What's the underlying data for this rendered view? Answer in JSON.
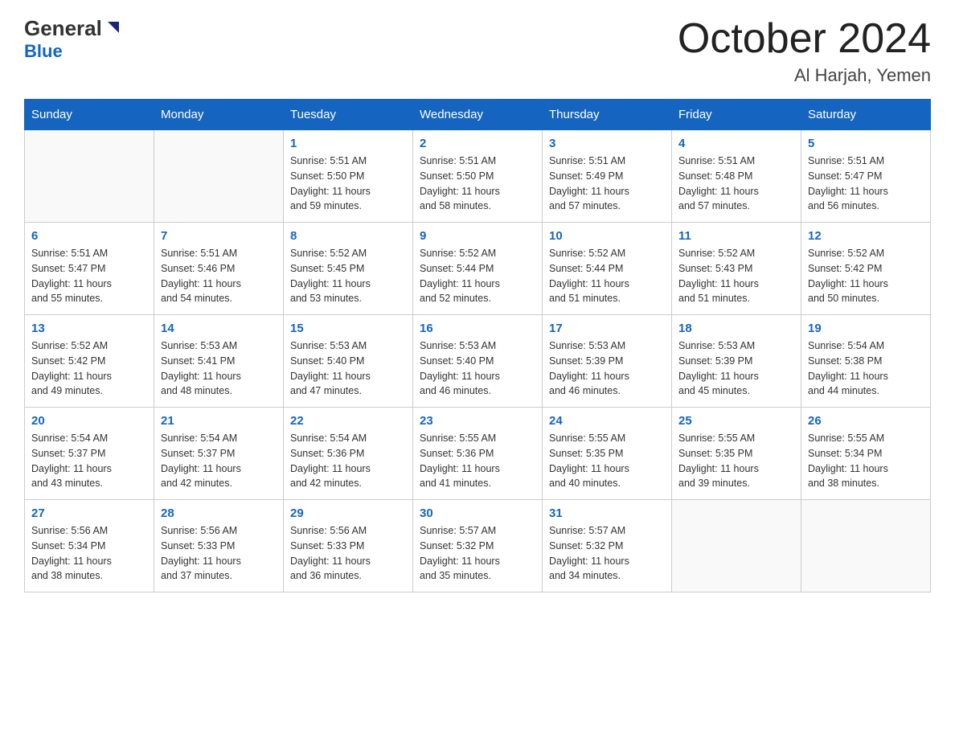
{
  "header": {
    "logo_general": "General",
    "logo_blue": "Blue",
    "title": "October 2024",
    "subtitle": "Al Harjah, Yemen"
  },
  "days_of_week": [
    "Sunday",
    "Monday",
    "Tuesday",
    "Wednesday",
    "Thursday",
    "Friday",
    "Saturday"
  ],
  "weeks": [
    [
      {
        "day": "",
        "info": ""
      },
      {
        "day": "",
        "info": ""
      },
      {
        "day": "1",
        "info": "Sunrise: 5:51 AM\nSunset: 5:50 PM\nDaylight: 11 hours\nand 59 minutes."
      },
      {
        "day": "2",
        "info": "Sunrise: 5:51 AM\nSunset: 5:50 PM\nDaylight: 11 hours\nand 58 minutes."
      },
      {
        "day": "3",
        "info": "Sunrise: 5:51 AM\nSunset: 5:49 PM\nDaylight: 11 hours\nand 57 minutes."
      },
      {
        "day": "4",
        "info": "Sunrise: 5:51 AM\nSunset: 5:48 PM\nDaylight: 11 hours\nand 57 minutes."
      },
      {
        "day": "5",
        "info": "Sunrise: 5:51 AM\nSunset: 5:47 PM\nDaylight: 11 hours\nand 56 minutes."
      }
    ],
    [
      {
        "day": "6",
        "info": "Sunrise: 5:51 AM\nSunset: 5:47 PM\nDaylight: 11 hours\nand 55 minutes."
      },
      {
        "day": "7",
        "info": "Sunrise: 5:51 AM\nSunset: 5:46 PM\nDaylight: 11 hours\nand 54 minutes."
      },
      {
        "day": "8",
        "info": "Sunrise: 5:52 AM\nSunset: 5:45 PM\nDaylight: 11 hours\nand 53 minutes."
      },
      {
        "day": "9",
        "info": "Sunrise: 5:52 AM\nSunset: 5:44 PM\nDaylight: 11 hours\nand 52 minutes."
      },
      {
        "day": "10",
        "info": "Sunrise: 5:52 AM\nSunset: 5:44 PM\nDaylight: 11 hours\nand 51 minutes."
      },
      {
        "day": "11",
        "info": "Sunrise: 5:52 AM\nSunset: 5:43 PM\nDaylight: 11 hours\nand 51 minutes."
      },
      {
        "day": "12",
        "info": "Sunrise: 5:52 AM\nSunset: 5:42 PM\nDaylight: 11 hours\nand 50 minutes."
      }
    ],
    [
      {
        "day": "13",
        "info": "Sunrise: 5:52 AM\nSunset: 5:42 PM\nDaylight: 11 hours\nand 49 minutes."
      },
      {
        "day": "14",
        "info": "Sunrise: 5:53 AM\nSunset: 5:41 PM\nDaylight: 11 hours\nand 48 minutes."
      },
      {
        "day": "15",
        "info": "Sunrise: 5:53 AM\nSunset: 5:40 PM\nDaylight: 11 hours\nand 47 minutes."
      },
      {
        "day": "16",
        "info": "Sunrise: 5:53 AM\nSunset: 5:40 PM\nDaylight: 11 hours\nand 46 minutes."
      },
      {
        "day": "17",
        "info": "Sunrise: 5:53 AM\nSunset: 5:39 PM\nDaylight: 11 hours\nand 46 minutes."
      },
      {
        "day": "18",
        "info": "Sunrise: 5:53 AM\nSunset: 5:39 PM\nDaylight: 11 hours\nand 45 minutes."
      },
      {
        "day": "19",
        "info": "Sunrise: 5:54 AM\nSunset: 5:38 PM\nDaylight: 11 hours\nand 44 minutes."
      }
    ],
    [
      {
        "day": "20",
        "info": "Sunrise: 5:54 AM\nSunset: 5:37 PM\nDaylight: 11 hours\nand 43 minutes."
      },
      {
        "day": "21",
        "info": "Sunrise: 5:54 AM\nSunset: 5:37 PM\nDaylight: 11 hours\nand 42 minutes."
      },
      {
        "day": "22",
        "info": "Sunrise: 5:54 AM\nSunset: 5:36 PM\nDaylight: 11 hours\nand 42 minutes."
      },
      {
        "day": "23",
        "info": "Sunrise: 5:55 AM\nSunset: 5:36 PM\nDaylight: 11 hours\nand 41 minutes."
      },
      {
        "day": "24",
        "info": "Sunrise: 5:55 AM\nSunset: 5:35 PM\nDaylight: 11 hours\nand 40 minutes."
      },
      {
        "day": "25",
        "info": "Sunrise: 5:55 AM\nSunset: 5:35 PM\nDaylight: 11 hours\nand 39 minutes."
      },
      {
        "day": "26",
        "info": "Sunrise: 5:55 AM\nSunset: 5:34 PM\nDaylight: 11 hours\nand 38 minutes."
      }
    ],
    [
      {
        "day": "27",
        "info": "Sunrise: 5:56 AM\nSunset: 5:34 PM\nDaylight: 11 hours\nand 38 minutes."
      },
      {
        "day": "28",
        "info": "Sunrise: 5:56 AM\nSunset: 5:33 PM\nDaylight: 11 hours\nand 37 minutes."
      },
      {
        "day": "29",
        "info": "Sunrise: 5:56 AM\nSunset: 5:33 PM\nDaylight: 11 hours\nand 36 minutes."
      },
      {
        "day": "30",
        "info": "Sunrise: 5:57 AM\nSunset: 5:32 PM\nDaylight: 11 hours\nand 35 minutes."
      },
      {
        "day": "31",
        "info": "Sunrise: 5:57 AM\nSunset: 5:32 PM\nDaylight: 11 hours\nand 34 minutes."
      },
      {
        "day": "",
        "info": ""
      },
      {
        "day": "",
        "info": ""
      }
    ]
  ]
}
